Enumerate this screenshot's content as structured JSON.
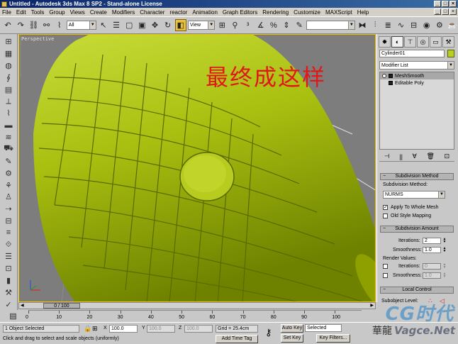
{
  "window": {
    "title": "Untitled - Autodesk 3ds Max 8 SP2 - Stand-alone License",
    "min": "_",
    "max": "□",
    "close": "×"
  },
  "menu": [
    "File",
    "Edit",
    "Tools",
    "Group",
    "Views",
    "Create",
    "Modifiers",
    "Character",
    "reactor",
    "Animation",
    "Graph Editors",
    "Rendering",
    "Customize",
    "MAXScript",
    "Help"
  ],
  "toolbar": {
    "selection_filter": "All",
    "ref_coord": "View"
  },
  "viewport": {
    "label": "Perspective",
    "overlay_text": "最终成这样"
  },
  "command_panel": {
    "object_name": "Cylinder01",
    "object_color": "#b8d020",
    "modifier_list": "Modifier List",
    "stack": [
      {
        "label": "MeshSmooth",
        "selected": true
      },
      {
        "label": "Editable Poly",
        "selected": false
      }
    ],
    "subdivision_method": {
      "title": "Subdivision Method",
      "method_label": "Subdivision Method:",
      "method_value": "NURMS",
      "apply_whole_mesh": "Apply To Whole Mesh",
      "apply_whole_mesh_checked": true,
      "old_style": "Old Style Mapping",
      "old_style_checked": false
    },
    "subdivision_amount": {
      "title": "Subdivision Amount",
      "iterations_label": "Iterations:",
      "iterations": "2",
      "smoothness_label": "Smoothness:",
      "smoothness": "1.0",
      "render_values_label": "Render Values:",
      "render_iterations_label": "Iterations:",
      "render_iterations": "0",
      "render_smoothness_label": "Smoothness:",
      "render_smoothness": "1.0"
    },
    "local_control": {
      "title": "Local Control",
      "subobject_label": "Subobject Level:"
    }
  },
  "time_slider": {
    "label": "0 / 100",
    "ticks": [
      "0",
      "10",
      "20",
      "30",
      "40",
      "50",
      "60",
      "70",
      "80",
      "90",
      "100"
    ]
  },
  "status": {
    "selected": "1 Object Selected",
    "prompt": "Click and drag to select and scale objects (uniformly)",
    "x_label": "X",
    "x_value": "100.0",
    "y_label": "Y",
    "y_value": "100.0",
    "z_label": "Z",
    "z_value": "100.0",
    "grid": "Grid = 25.4cm",
    "add_time_tag": "Add Time Tag",
    "auto_key": "Auto Key",
    "set_key": "Set Key",
    "key_mode": "Selected",
    "key_filters": "Key Filters..."
  },
  "watermark": {
    "brand": "CG时代",
    "site": "Vagce.Net",
    "chinese": "華龍"
  }
}
